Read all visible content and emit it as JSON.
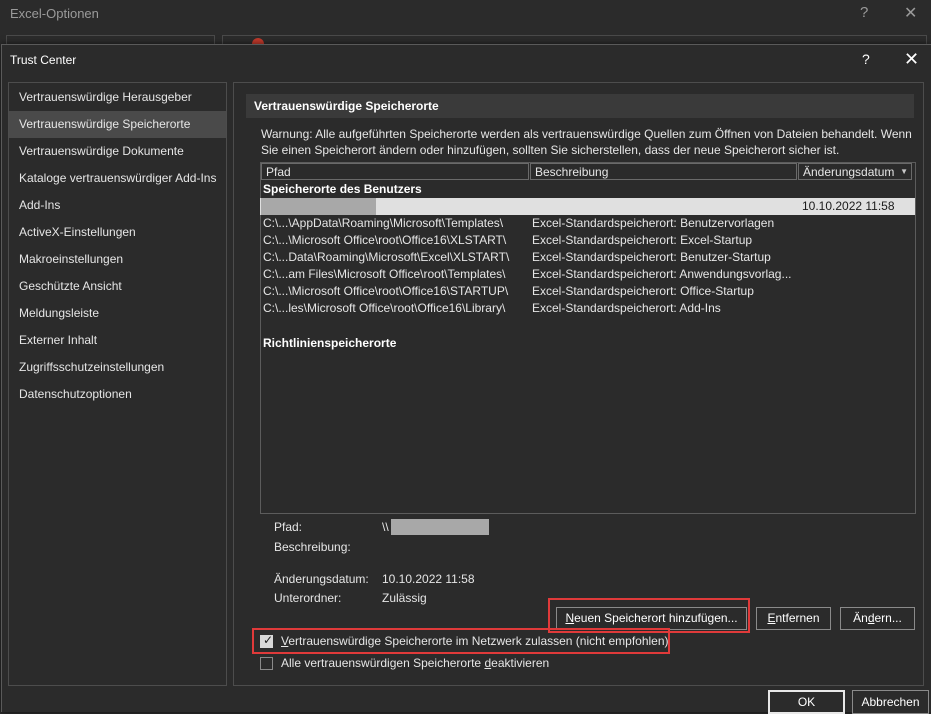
{
  "parent_window": {
    "title": "Excel-Optionen",
    "help": "?",
    "close": "✕"
  },
  "dialog": {
    "title": "Trust Center",
    "help": "?",
    "close": "✕"
  },
  "sidebar": {
    "items": [
      {
        "label": "Vertrauenswürdige Herausgeber",
        "selected": false
      },
      {
        "label": "Vertrauenswürdige Speicherorte",
        "selected": true
      },
      {
        "label": "Vertrauenswürdige Dokumente",
        "selected": false
      },
      {
        "label": "Kataloge vertrauenswürdiger Add-Ins",
        "selected": false
      },
      {
        "label": "Add-Ins",
        "selected": false
      },
      {
        "label": "ActiveX-Einstellungen",
        "selected": false
      },
      {
        "label": "Makroeinstellungen",
        "selected": false
      },
      {
        "label": "Geschützte Ansicht",
        "selected": false
      },
      {
        "label": "Meldungsleiste",
        "selected": false
      },
      {
        "label": "Externer Inhalt",
        "selected": false
      },
      {
        "label": "Zugriffsschutzeinstellungen",
        "selected": false
      },
      {
        "label": "Datenschutzoptionen",
        "selected": false
      }
    ]
  },
  "main": {
    "section_title": "Vertrauenswürdige Speicherorte",
    "warning_line1": "Warnung: Alle aufgeführten Speicherorte werden als vertrauenswürdige Quellen zum Öffnen von Dateien behandelt. Wenn",
    "warning_line2": "Sie einen Speicherort ändern oder hinzufügen, sollten Sie sicherstellen, dass der neue Speicherort sicher ist.",
    "columns": {
      "path": "Pfad",
      "description": "Beschreibung",
      "date": "Änderungsdatum",
      "sort_arrow": "▼"
    },
    "user_group_label": "Speicherorte des Benutzers",
    "selected_row": {
      "date": "10.10.2022 11:58"
    },
    "rows": [
      {
        "path": "C:\\...\\AppData\\Roaming\\Microsoft\\Templates\\",
        "description": "Excel-Standardspeicherort: Benutzervorlagen"
      },
      {
        "path": "C:\\...\\Microsoft Office\\root\\Office16\\XLSTART\\",
        "description": "Excel-Standardspeicherort: Excel-Startup"
      },
      {
        "path": "C:\\...Data\\Roaming\\Microsoft\\Excel\\XLSTART\\",
        "description": "Excel-Standardspeicherort: Benutzer-Startup"
      },
      {
        "path": "C:\\...am Files\\Microsoft Office\\root\\Templates\\",
        "description": "Excel-Standardspeicherort: Anwendungsvorlag..."
      },
      {
        "path": "C:\\...\\Microsoft Office\\root\\Office16\\STARTUP\\",
        "description": "Excel-Standardspeicherort: Office-Startup"
      },
      {
        "path": "C:\\...les\\Microsoft Office\\root\\Office16\\Library\\",
        "description": "Excel-Standardspeicherort: Add-Ins"
      }
    ],
    "policy_group_label": "Richtlinienspeicherorte",
    "details": {
      "path_label": "Pfad:",
      "path_value": "\\\\",
      "description_label": "Beschreibung:",
      "date_label": "Änderungsdatum:",
      "date_value": "10.10.2022 11:58",
      "subfolders_label": "Unterordner:",
      "subfolders_value": "Zulässig"
    },
    "buttons": {
      "add_pre": "",
      "add_key": "N",
      "add_post": "euen Speicherort hinzufügen...",
      "remove_pre": "",
      "remove_key": "E",
      "remove_post": "ntfernen",
      "change_pre": "Än",
      "change_key": "d",
      "change_post": "ern..."
    },
    "options": {
      "network_pre": "",
      "network_key": "V",
      "network_post": "ertrauenswürdige Speicherorte im Netzwerk zulassen (nicht empfohlen)",
      "network_checked": true,
      "disable_pre": "Alle vertrauenswürdigen Speicherorte ",
      "disable_key": "d",
      "disable_post": "eaktivieren",
      "disable_checked": false
    }
  },
  "footer": {
    "ok_label": "OK",
    "cancel_label": "Abbrechen"
  },
  "colors": {
    "background": "#2b2b2b",
    "highlight_red": "#e03a3a",
    "selected_row": "#e0e0e0"
  }
}
